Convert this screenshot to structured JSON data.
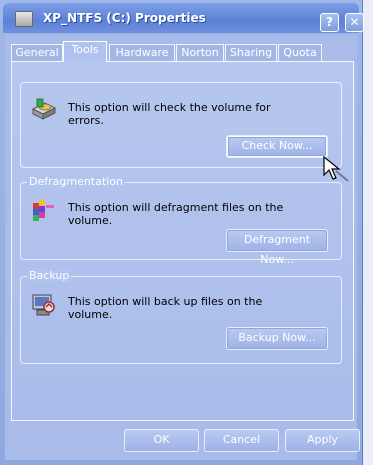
{
  "window": {
    "title": "XP_NTFS (C:) Properties",
    "help": "?",
    "close": "✕"
  },
  "tabs": [
    {
      "label": "General"
    },
    {
      "label": "Tools"
    },
    {
      "label": "Hardware"
    },
    {
      "label": "Norton"
    },
    {
      "label": "Sharing"
    },
    {
      "label": "Quota"
    }
  ],
  "active_tab": "Tools",
  "error_check": {
    "text": "This option will check the volume for errors.",
    "button": "Check Now..."
  },
  "defrag": {
    "title": "Defragmentation",
    "text": "This option will defragment files on the volume.",
    "button": "Defragment Now..."
  },
  "backup": {
    "title": "Backup",
    "text": "This option will back up files on the volume.",
    "button": "Backup Now..."
  },
  "footer": {
    "ok": "OK",
    "cancel": "Cancel",
    "apply": "Apply"
  },
  "colors": {
    "titlebar": "#5d81d6",
    "dialog": "#a8bbe9",
    "button_text": "#ffffff"
  },
  "icons": [
    "drive-icon",
    "defragment-icon",
    "backup-icon",
    "pointer-cursor-icon"
  ]
}
